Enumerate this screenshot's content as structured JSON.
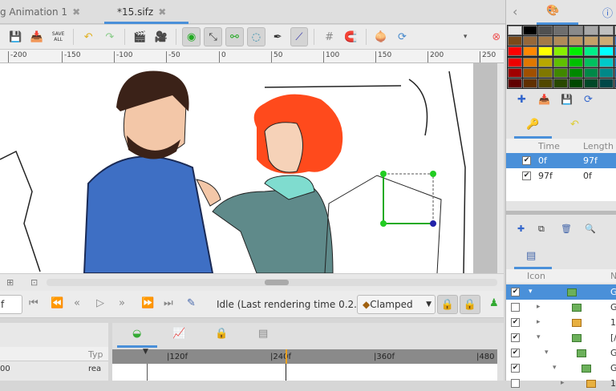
{
  "tabs": [
    {
      "label": "g Animation 1",
      "close": "✖"
    },
    {
      "label": "*15.sifz",
      "close": "✖"
    }
  ],
  "toolbar": {
    "save_all": "SAVE ALL"
  },
  "ruler": [
    "-200",
    "-150",
    "-100",
    "-50",
    "0",
    "50",
    "100",
    "150",
    "200",
    "250"
  ],
  "playback": {
    "frame": "f",
    "status": "Idle (Last rendering time 0.2...",
    "interpolation": "Clamped"
  },
  "params": {
    "type_header": "Typ",
    "row_value": "00",
    "row_type": "rea"
  },
  "timetrack": {
    "labels": [
      "|120f",
      "|240f",
      "|360f",
      "|480"
    ]
  },
  "palette": [
    [
      "#e8e8e8",
      "#000000",
      "#505050",
      "#6e6e6e",
      "#8a8a8a",
      "#a8a8a8",
      "#c0c0c0",
      "#d8d8d8"
    ],
    [
      "#7a4a1a",
      "#96683a",
      "#a47a48",
      "#b08a58",
      "#bb9560",
      "#c4a068",
      "#cdaa74",
      "#3a7ad0"
    ],
    [
      "#ff0000",
      "#ff8800",
      "#ffff00",
      "#88ee00",
      "#00ee00",
      "#00ee88",
      "#00ffff",
      "#0088ff"
    ],
    [
      "#ee0000",
      "#e07800",
      "#b8a800",
      "#60c000",
      "#00c000",
      "#00c060",
      "#00c8c8",
      "#0070d0"
    ],
    [
      "#a00000",
      "#a05000",
      "#807800",
      "#408800",
      "#008800",
      "#008848",
      "#008888",
      "#005098"
    ],
    [
      "#600000",
      "#603000",
      "#504800",
      "#284800",
      "#004800",
      "#004828",
      "#004848",
      "#003060"
    ]
  ],
  "waypoints": {
    "headers": [
      "Time",
      "Length"
    ],
    "rows": [
      {
        "time": "0f",
        "length": "97f",
        "checked": true,
        "selected": true
      },
      {
        "time": "97f",
        "length": "0f",
        "checked": true,
        "selected": false
      }
    ]
  },
  "layers": {
    "headers": [
      "Icon",
      "N"
    ],
    "rows": [
      {
        "name": "G",
        "checked": true,
        "expander": "▾",
        "depth": 0,
        "color": "green",
        "selected": true
      },
      {
        "name": "G",
        "checked": false,
        "expander": "▸",
        "depth": 1,
        "color": "green"
      },
      {
        "name": "1",
        "checked": true,
        "expander": "▸",
        "depth": 1,
        "color": "yellow"
      },
      {
        "name": "[/",
        "checked": true,
        "expander": "▾",
        "depth": 1,
        "color": "green"
      },
      {
        "name": "G",
        "checked": true,
        "expander": "▾",
        "depth": 2,
        "color": "green"
      },
      {
        "name": "G",
        "checked": true,
        "expander": "▾",
        "depth": 3,
        "color": "green"
      },
      {
        "name": "1",
        "checked": false,
        "expander": "▸",
        "depth": 4,
        "color": "yellow"
      }
    ]
  }
}
